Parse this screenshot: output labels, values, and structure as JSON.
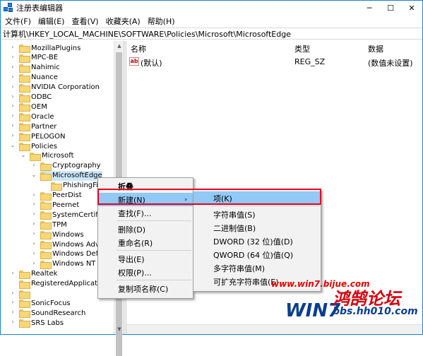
{
  "window": {
    "title": "注册表编辑器",
    "minimize": "─",
    "maximize": "☐",
    "close": "✕"
  },
  "menu": [
    "文件(F)",
    "编辑(E)",
    "查看(V)",
    "收藏夹(A)",
    "帮助(H)"
  ],
  "address": "计算机\\HKEY_LOCAL_MACHINE\\SOFTWARE\\Policies\\Microsoft\\MicrosoftEdge",
  "tree": [
    {
      "label": "MozillaPlugins",
      "expandable": true,
      "expanded": false
    },
    {
      "label": "MPC-BE",
      "expandable": true,
      "expanded": false
    },
    {
      "label": "Nahimic",
      "expandable": true,
      "expanded": false
    },
    {
      "label": "Nuance",
      "expandable": true,
      "expanded": false
    },
    {
      "label": "NVIDIA Corporation",
      "expandable": true,
      "expanded": false
    },
    {
      "label": "ODBC",
      "expandable": true,
      "expanded": false
    },
    {
      "label": "OEM",
      "expandable": true,
      "expanded": false
    },
    {
      "label": "Oracle",
      "expandable": true,
      "expanded": false
    },
    {
      "label": "Partner",
      "expandable": true,
      "expanded": false
    },
    {
      "label": "PELOGON",
      "expandable": true,
      "expanded": false
    },
    {
      "label": "Policies",
      "expandable": true,
      "expanded": true
    },
    {
      "label": "Microsoft",
      "expandable": true,
      "expanded": true
    },
    {
      "label": "Cryptography",
      "expandable": true,
      "expanded": false
    },
    {
      "label": "MicrosoftEdge",
      "expandable": true,
      "expanded": true,
      "selected": true
    },
    {
      "label": "PhishingFi",
      "expandable": false,
      "expanded": false
    },
    {
      "label": "PeerDist",
      "expandable": true,
      "expanded": false
    },
    {
      "label": "Peernet",
      "expandable": true,
      "expanded": false
    },
    {
      "label": "SystemCertific",
      "expandable": true,
      "expanded": false
    },
    {
      "label": "TPM",
      "expandable": true,
      "expanded": false
    },
    {
      "label": "Windows",
      "expandable": true,
      "expanded": false
    },
    {
      "label": "Windows Adv",
      "expandable": true,
      "expanded": false
    },
    {
      "label": "Windows Defe",
      "expandable": true,
      "expanded": false
    },
    {
      "label": "Windows NT",
      "expandable": true,
      "expanded": false
    },
    {
      "label": "Realtek",
      "expandable": true,
      "expanded": false
    },
    {
      "label": "RegisteredApplications",
      "expandable": false,
      "expanded": false
    },
    {
      "label": "",
      "expandable": true,
      "expanded": false
    },
    {
      "label": "SonicFocus",
      "expandable": true,
      "expanded": false
    },
    {
      "label": "SoundResearch",
      "expandable": true,
      "expanded": false
    },
    {
      "label": "SRS Labs",
      "expandable": true,
      "expanded": false
    }
  ],
  "columns": {
    "name": "名称",
    "type": "类型",
    "data": "数据"
  },
  "values": [
    {
      "icon": "ab",
      "name": "(默认)",
      "type": "REG_SZ",
      "data": "(数值未设置)"
    }
  ],
  "context_menu": [
    {
      "label": "折叠",
      "bold": true
    },
    {
      "label": "新建(N)",
      "submenu": true,
      "highlighted": true
    },
    {
      "label": "查找(F)..."
    },
    {
      "separator": true
    },
    {
      "label": "删除(D)"
    },
    {
      "label": "重命名(R)"
    },
    {
      "separator": true
    },
    {
      "label": "导出(E)"
    },
    {
      "label": "权限(P)..."
    },
    {
      "separator": true
    },
    {
      "label": "复制项名称(C)"
    }
  ],
  "submenu": [
    {
      "label": "项(K)",
      "highlighted": true
    },
    {
      "separator": true
    },
    {
      "label": "字符串值(S)"
    },
    {
      "label": "二进制值(B)"
    },
    {
      "label": "DWORD (32 位)值(D)"
    },
    {
      "label": "QWORD (64 位)值(Q)"
    },
    {
      "label": "多字符串值(M)"
    },
    {
      "label": "可扩充字符串值(E)"
    }
  ],
  "watermark": {
    "brand": "鸿鹄论坛",
    "url": "bbs.hh010.com",
    "overlay": "www.win7.bijue.com",
    "logo": "WIN7"
  }
}
